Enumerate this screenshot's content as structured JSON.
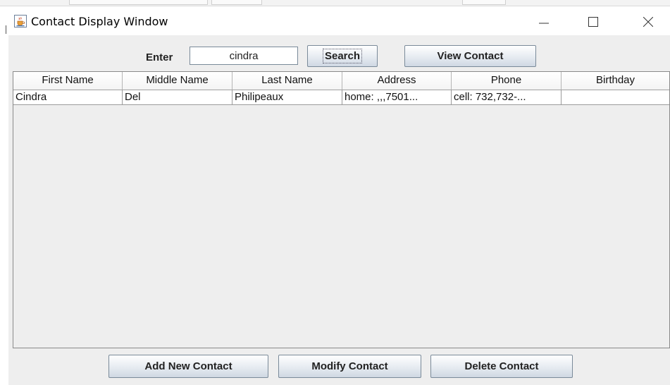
{
  "window": {
    "title": "Contact Display Window"
  },
  "search": {
    "label": "Enter",
    "value": "cindra",
    "search_button": "Search",
    "view_button": "View Contact"
  },
  "table": {
    "columns": [
      "First Name",
      "Middle Name",
      "Last Name",
      "Address",
      "Phone",
      "Birthday"
    ],
    "rows": [
      [
        "Cindra",
        "Del",
        "Philipeaux",
        "home: ,,,7501...",
        "cell: 732,732-...",
        ""
      ]
    ]
  },
  "actions": {
    "add": "Add New Contact",
    "modify": "Modify Contact",
    "delete": "Delete Contact"
  },
  "icons": {
    "app": "java-coffee-icon",
    "minimize": "minimize-icon",
    "maximize": "maximize-icon",
    "close": "close-icon"
  }
}
